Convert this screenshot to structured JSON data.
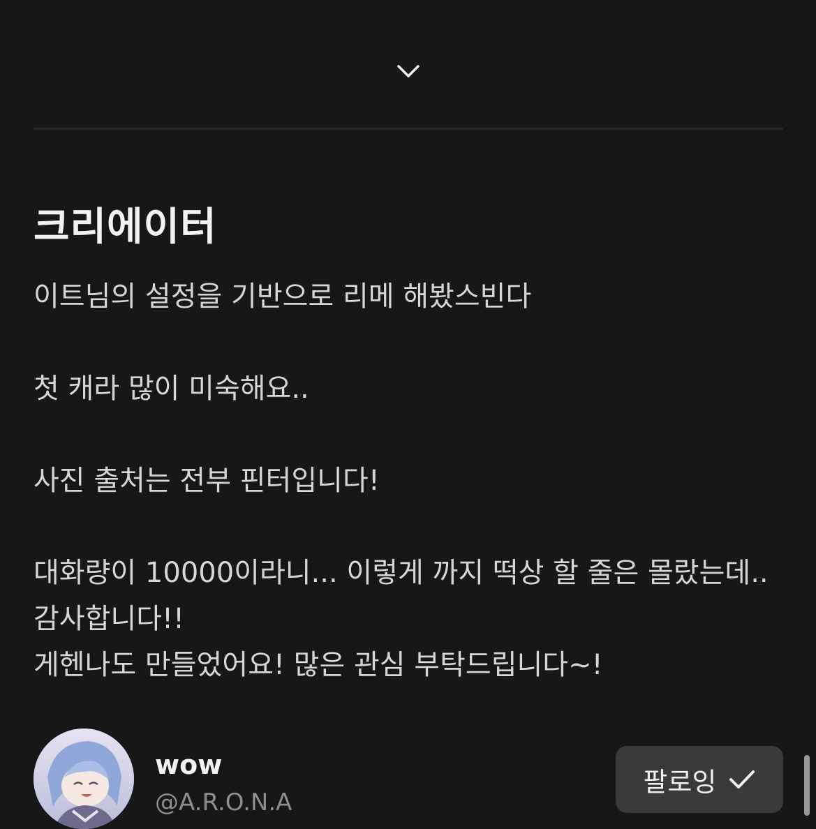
{
  "section": {
    "title": "크리에이터",
    "description": "이트님의 설정을 기반으로 리메 해봤스빈다\n\n첫 캐라 많이 미숙해요..\n\n사진 출처는 전부 핀터입니다!\n\n대화량이 10000이라니... 이렇게 까지 떡상 할 줄은 몰랐는데.. 감사합니다!!\n게헨나도 만들었어요! 많은 관심 부탁드립니다~!"
  },
  "creator": {
    "name": "wow",
    "handle": "@A.R.O.N.A",
    "follow_label": "팔로잉"
  },
  "icons": {
    "collapse": "chevron-down-icon",
    "follow_state": "check-icon"
  },
  "colors": {
    "background": "#171717",
    "follow_button": "#3a3a3a"
  }
}
